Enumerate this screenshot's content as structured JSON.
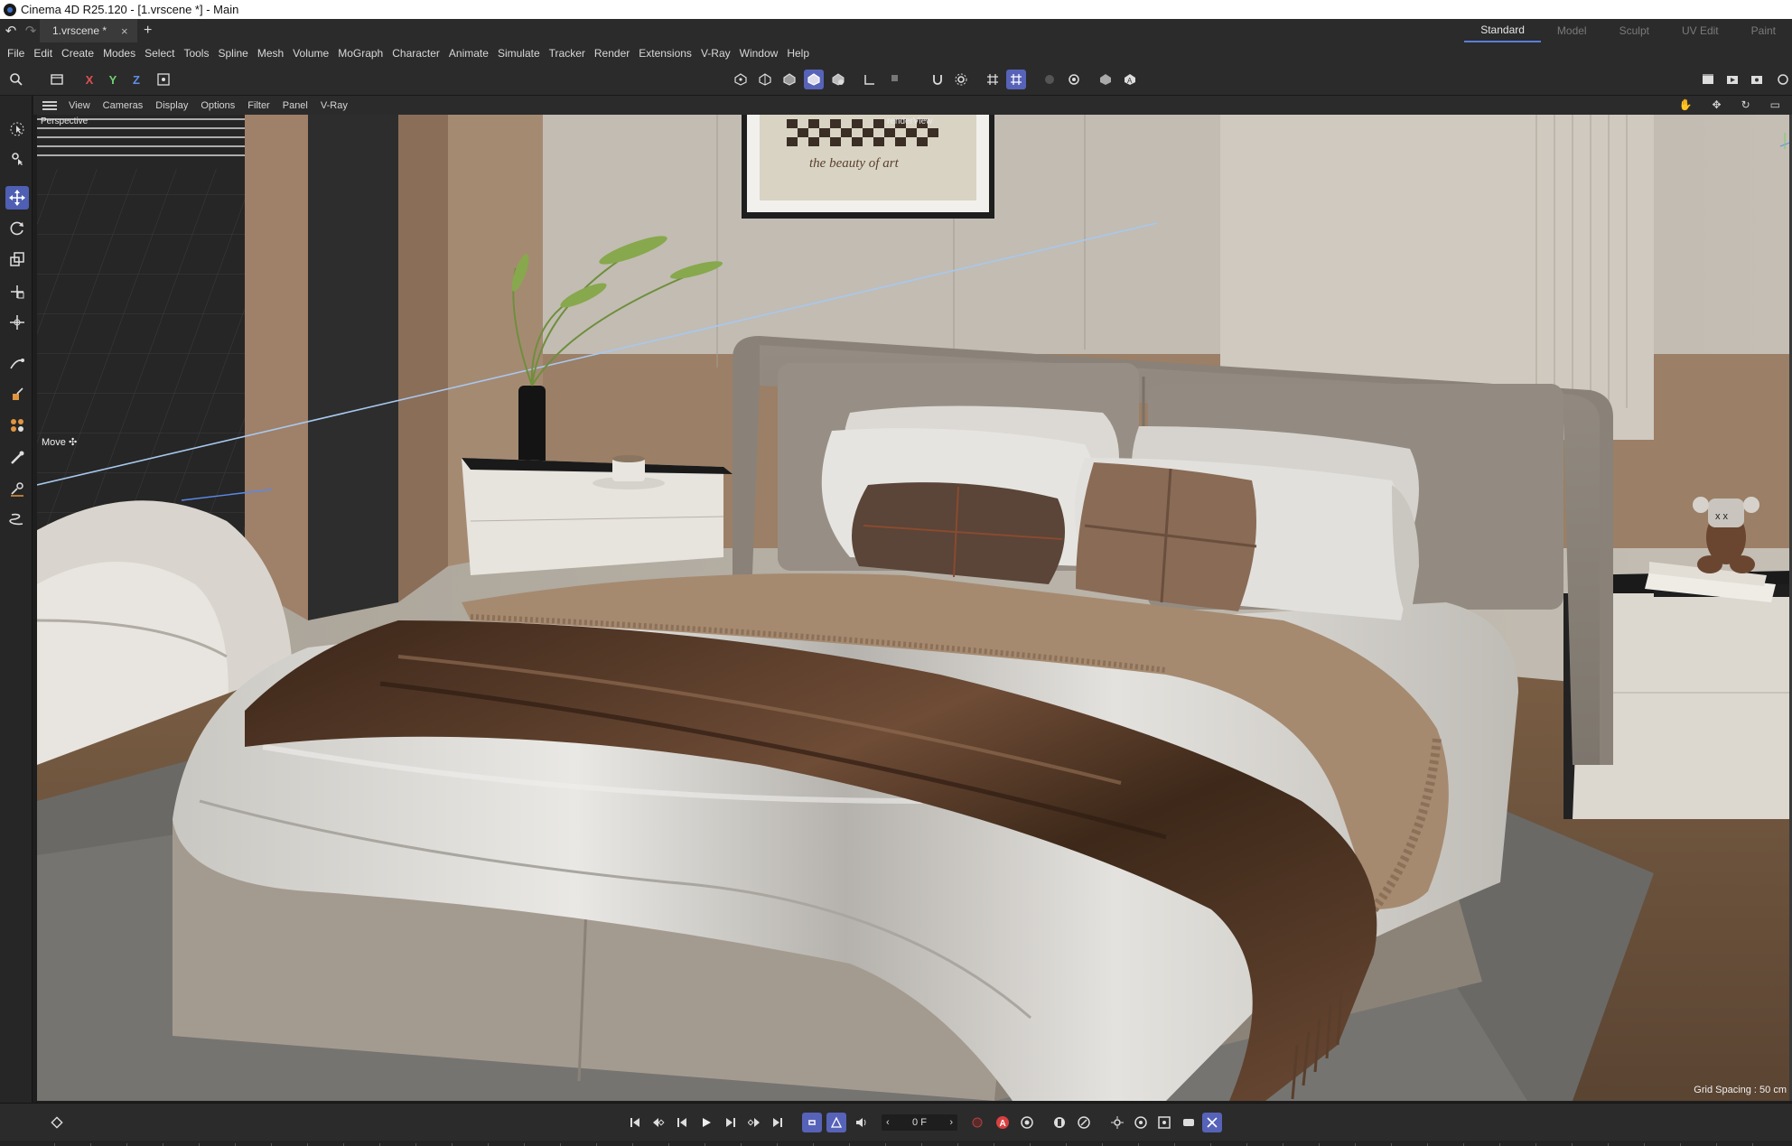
{
  "window": {
    "title": "Cinema 4D R25.120 - [1.vrscene *] - Main"
  },
  "tabs": {
    "document": "1.vrscene *",
    "close": "×",
    "new": "+",
    "undo": "↶",
    "redo": "↷"
  },
  "layouts": [
    "Standard",
    "Model",
    "Sculpt",
    "UV Edit",
    "Paint"
  ],
  "menu": [
    "File",
    "Edit",
    "Create",
    "Modes",
    "Select",
    "Tools",
    "Spline",
    "Mesh",
    "Volume",
    "MoGraph",
    "Character",
    "Animate",
    "Simulate",
    "Tracker",
    "Render",
    "Extensions",
    "V-Ray",
    "Window",
    "Help"
  ],
  "toolbar": {
    "axis_x": "X",
    "axis_y": "Y",
    "axis_z": "Z"
  },
  "viewport_menu": [
    "View",
    "Cameras",
    "Display",
    "Options",
    "Filter",
    "Panel",
    "V-Ray"
  ],
  "viewport": {
    "perspective_label": "Perspective",
    "render_view_label": "renderView",
    "tool_label": "Move",
    "grid_spacing": "Grid Spacing : 50 cm",
    "painting_text": "the beauty of art"
  },
  "timeline": {
    "frame_value": "0 F",
    "prev_arrow": "‹",
    "next_arrow": "›",
    "record_auto_label": "A"
  },
  "colors": {
    "accent": "#5663b8",
    "active_layout_underline": "#5a7fd6",
    "record_red": "#d94040"
  },
  "icons": [
    "search-icon",
    "live-select-icon",
    "move-icon",
    "rotate-icon",
    "scale-icon",
    "render-icon",
    "play-icon",
    "record-icon"
  ]
}
